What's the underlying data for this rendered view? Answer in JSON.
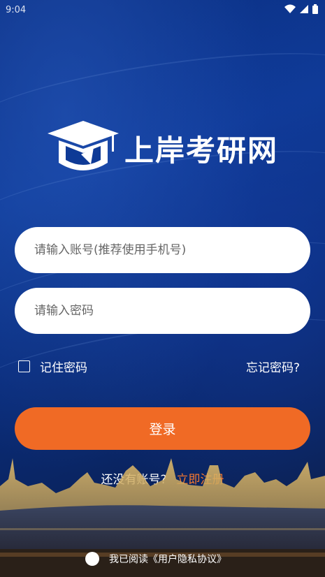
{
  "status_bar": {
    "time": "9:04"
  },
  "brand": {
    "name": "上岸考研网"
  },
  "form": {
    "account_placeholder": "请输入账号(推荐使用手机号)",
    "password_placeholder": "请输入密码",
    "remember_label": "记住密码",
    "forgot_label": "忘记密码?",
    "login_label": "登录"
  },
  "register": {
    "prompt": "还没有账号?",
    "link": "立即注册"
  },
  "agreement": {
    "text": "我已阅读《用户隐私协议》"
  },
  "colors": {
    "accent": "#f06a25",
    "link": "#f5782f",
    "background": "#0e3a96"
  },
  "icons": [
    "wifi-icon",
    "signal-icon",
    "battery-icon",
    "graduation-cap-logo-icon"
  ]
}
